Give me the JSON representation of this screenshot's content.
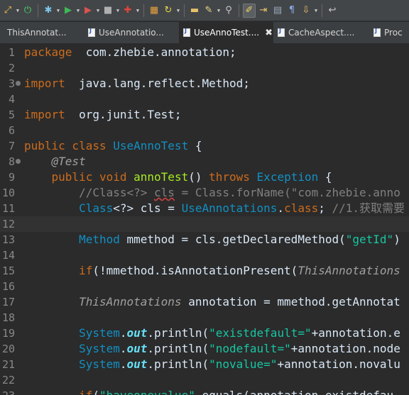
{
  "toolbar": {
    "buttons": [
      {
        "icon": "toggle-mark-occurrences-icon",
        "glyph": "⤢",
        "color": "#f0c040",
        "dropdown": true
      },
      {
        "icon": "power-icon",
        "glyph": "⏻",
        "color": "#4cd964",
        "dropdown": false
      },
      {
        "icon": "debug-icon",
        "glyph": "✱",
        "color": "#7cc8e8",
        "dropdown": true
      },
      {
        "icon": "run-icon",
        "glyph": "▶",
        "color": "#3cba54",
        "dropdown": true
      },
      {
        "icon": "run-coverage-icon",
        "glyph": "▶",
        "color": "#d9534f",
        "dropdown": true
      },
      {
        "icon": "stop-icon",
        "glyph": "■",
        "color": "#b0b0b0",
        "dropdown": true
      },
      {
        "icon": "external-tools-icon",
        "glyph": "✚",
        "color": "#e0443a",
        "dropdown": true
      },
      {
        "icon": "new-java-project-icon",
        "glyph": "▦",
        "color": "#e8a33d",
        "dropdown": false
      },
      {
        "icon": "refresh-icon",
        "glyph": "↻",
        "color": "#e8d44d",
        "dropdown": true
      },
      {
        "icon": "open-folder-icon",
        "glyph": "▬",
        "color": "#e8c26a",
        "dropdown": false
      },
      {
        "icon": "pen-icon",
        "glyph": "✎",
        "color": "#e8d88a",
        "dropdown": true
      },
      {
        "icon": "filter-icon",
        "glyph": "⚲",
        "color": "#c8c8c8",
        "dropdown": false
      },
      {
        "icon": "toggle-highlight-icon",
        "glyph": "✐",
        "color": "#f0d060",
        "dropdown": false,
        "active": true
      },
      {
        "icon": "next-annotation-icon",
        "glyph": "⇥",
        "color": "#e8c26a",
        "dropdown": false
      },
      {
        "icon": "show-whitespace-icon",
        "glyph": "▤",
        "color": "#9ab",
        "dropdown": false
      },
      {
        "icon": "pilcrow-icon",
        "glyph": "¶",
        "color": "#8aa8e0",
        "dropdown": false
      },
      {
        "icon": "download-icon",
        "glyph": "⇩",
        "color": "#e8c26a",
        "dropdown": true
      },
      {
        "icon": "navigate-icon",
        "glyph": "↩",
        "color": "#c8c8c8",
        "dropdown": false
      }
    ]
  },
  "tabs": [
    {
      "label": "ThisAnnotat...",
      "active": false,
      "close": false
    },
    {
      "label": "UseAnnotatio...",
      "active": false,
      "close": false
    },
    {
      "label": "UseAnnoTest....",
      "active": true,
      "close": true
    },
    {
      "label": "CacheAspect....",
      "active": false,
      "close": false
    },
    {
      "label": "Proc",
      "active": false,
      "close": false
    }
  ],
  "editor": {
    "lines": [
      {
        "n": "1",
        "fold": false,
        "segs": [
          [
            "kw",
            "package"
          ],
          [
            "",
            "  com.zhebie.annotation;"
          ]
        ]
      },
      {
        "n": "2",
        "fold": false,
        "segs": []
      },
      {
        "n": "3",
        "fold": true,
        "segs": [
          [
            "kw",
            "import"
          ],
          [
            "",
            "  java.lang.reflect.Method;"
          ]
        ]
      },
      {
        "n": "4",
        "fold": false,
        "segs": []
      },
      {
        "n": "5",
        "fold": false,
        "segs": [
          [
            "kw",
            "import"
          ],
          [
            "",
            "  org.junit.Test;"
          ]
        ]
      },
      {
        "n": "6",
        "fold": false,
        "segs": []
      },
      {
        "n": "7",
        "fold": false,
        "segs": [
          [
            "kw",
            "public class"
          ],
          [
            "",
            " "
          ],
          [
            "ty",
            "UseAnnoTest"
          ],
          [
            "",
            " {"
          ]
        ]
      },
      {
        "n": "8",
        "fold": true,
        "segs": [
          [
            "",
            "    "
          ],
          [
            "an",
            "@Test"
          ]
        ]
      },
      {
        "n": "9",
        "fold": false,
        "segs": [
          [
            "",
            "    "
          ],
          [
            "kw",
            "public void"
          ],
          [
            "",
            " "
          ],
          [
            "fn",
            "annoTest"
          ],
          [
            "",
            "() "
          ],
          [
            "kw",
            "throws"
          ],
          [
            "",
            " "
          ],
          [
            "ty",
            "Exception"
          ],
          [
            "",
            " {"
          ]
        ]
      },
      {
        "n": "10",
        "fold": false,
        "segs": [
          [
            "",
            "        "
          ],
          [
            "cm",
            "//Class<?> "
          ],
          [
            "cm sq",
            "cls"
          ],
          [
            "cm",
            " = Class.forName(\"com.zhebie.anno"
          ]
        ]
      },
      {
        "n": "11",
        "fold": false,
        "segs": [
          [
            "",
            "        "
          ],
          [
            "ty",
            "Class"
          ],
          [
            "",
            "<?> cls = "
          ],
          [
            "ty",
            "UseAnnotations"
          ],
          [
            "",
            "."
          ],
          [
            "kw",
            "class"
          ],
          [
            "",
            "; "
          ],
          [
            "cm",
            "//1.获取需要"
          ]
        ]
      },
      {
        "n": "12",
        "fold": false,
        "hl": true,
        "segs": []
      },
      {
        "n": "13",
        "fold": false,
        "segs": [
          [
            "",
            "        "
          ],
          [
            "ty",
            "Method"
          ],
          [
            "",
            " mmethod = cls.getDeclaredMethod("
          ],
          [
            "st",
            "\"getId\""
          ],
          [
            "",
            ")"
          ]
        ]
      },
      {
        "n": "14",
        "fold": false,
        "segs": []
      },
      {
        "n": "15",
        "fold": false,
        "segs": [
          [
            "",
            "        "
          ],
          [
            "kw",
            "if"
          ],
          [
            "",
            "(!mmethod.isAnnotationPresent("
          ],
          [
            "it",
            "ThisAnnotations"
          ]
        ]
      },
      {
        "n": "16",
        "fold": false,
        "segs": []
      },
      {
        "n": "17",
        "fold": false,
        "segs": [
          [
            "",
            "        "
          ],
          [
            "it",
            "ThisAnnotations"
          ],
          [
            "",
            " annotation = mmethod.getAnnotat"
          ]
        ]
      },
      {
        "n": "18",
        "fold": false,
        "segs": []
      },
      {
        "n": "19",
        "fold": false,
        "segs": [
          [
            "",
            "        "
          ],
          [
            "ty",
            "System"
          ],
          [
            "",
            "."
          ],
          [
            "fi",
            "out"
          ],
          [
            "",
            ".println("
          ],
          [
            "st",
            "\"existdefault=\""
          ],
          [
            "",
            "+annotation.e"
          ]
        ]
      },
      {
        "n": "20",
        "fold": false,
        "segs": [
          [
            "",
            "        "
          ],
          [
            "ty",
            "System"
          ],
          [
            "",
            "."
          ],
          [
            "fi",
            "out"
          ],
          [
            "",
            ".println("
          ],
          [
            "st",
            "\"nodefault=\""
          ],
          [
            "",
            "+annotation.node"
          ]
        ]
      },
      {
        "n": "21",
        "fold": false,
        "segs": [
          [
            "",
            "        "
          ],
          [
            "ty",
            "System"
          ],
          [
            "",
            "."
          ],
          [
            "fi",
            "out"
          ],
          [
            "",
            ".println("
          ],
          [
            "st",
            "\"novalue=\""
          ],
          [
            "",
            "+annotation.novalu"
          ]
        ]
      },
      {
        "n": "22",
        "fold": false,
        "segs": []
      },
      {
        "n": "23",
        "fold": false,
        "segs": [
          [
            "",
            "        "
          ],
          [
            "kw",
            "if"
          ],
          [
            "",
            "("
          ],
          [
            "st",
            "\"haveonevalue\""
          ],
          [
            "",
            ".equals(annotation.existdefau"
          ]
        ]
      }
    ]
  }
}
